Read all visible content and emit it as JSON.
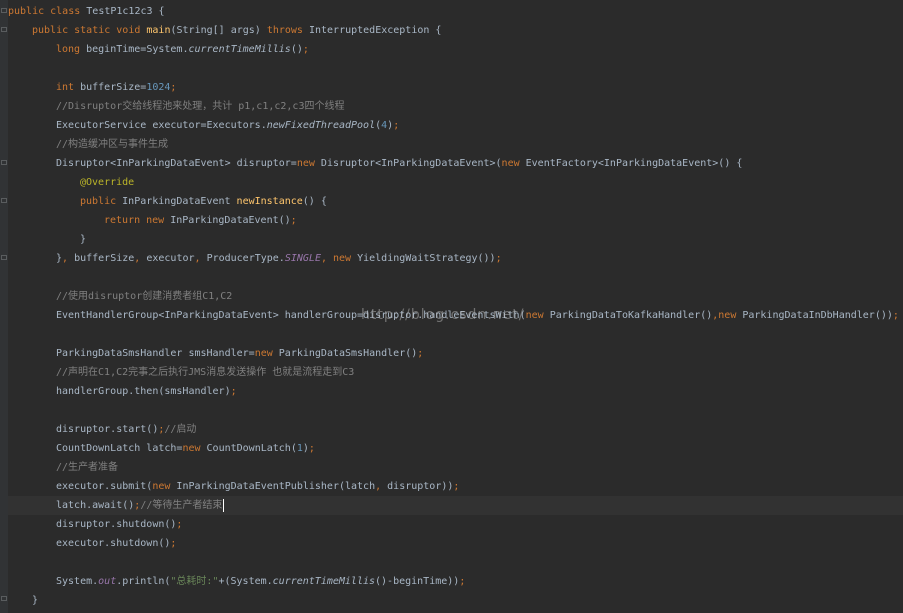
{
  "editor": {
    "language": "java",
    "theme": "Darcula",
    "lines": [
      {
        "indent": 0,
        "tokens": [
          {
            "t": "kw",
            "v": "public class "
          },
          {
            "t": "tx",
            "v": "TestP1c12c3 {"
          }
        ]
      },
      {
        "indent": 1,
        "tokens": [
          {
            "t": "kw",
            "v": "public static void "
          },
          {
            "t": "fn",
            "v": "main"
          },
          {
            "t": "tx",
            "v": "(String[] args) "
          },
          {
            "t": "kw",
            "v": "throws "
          },
          {
            "t": "tx",
            "v": "InterruptedException {"
          }
        ]
      },
      {
        "indent": 2,
        "tokens": [
          {
            "t": "kw",
            "v": "long "
          },
          {
            "t": "tx",
            "v": "beginTime=System."
          },
          {
            "t": "st",
            "v": "currentTimeMillis"
          },
          {
            "t": "tx",
            "v": "()"
          },
          {
            "t": "kw",
            "v": ";"
          }
        ]
      },
      {
        "indent": 0,
        "tokens": []
      },
      {
        "indent": 2,
        "tokens": [
          {
            "t": "kw",
            "v": "int "
          },
          {
            "t": "tx",
            "v": "bufferSize="
          },
          {
            "t": "num",
            "v": "1024"
          },
          {
            "t": "kw",
            "v": ";"
          }
        ]
      },
      {
        "indent": 2,
        "tokens": [
          {
            "t": "cm",
            "v": "//Disruptor交给线程池来处理，共计 p1,c1,c2,c3四个线程"
          }
        ]
      },
      {
        "indent": 2,
        "tokens": [
          {
            "t": "tx",
            "v": "ExecutorService executor=Executors."
          },
          {
            "t": "st",
            "v": "newFixedThreadPool"
          },
          {
            "t": "tx",
            "v": "("
          },
          {
            "t": "num",
            "v": "4"
          },
          {
            "t": "tx",
            "v": ")"
          },
          {
            "t": "kw",
            "v": ";"
          }
        ]
      },
      {
        "indent": 2,
        "tokens": [
          {
            "t": "cm",
            "v": "//构造缓冲区与事件生成"
          }
        ]
      },
      {
        "indent": 2,
        "tokens": [
          {
            "t": "tx",
            "v": "Disruptor<InParkingDataEvent> disruptor="
          },
          {
            "t": "kw",
            "v": "new "
          },
          {
            "t": "tx",
            "v": "Disruptor<InParkingDataEvent>("
          },
          {
            "t": "kw",
            "v": "new "
          },
          {
            "t": "tx",
            "v": "EventFactory<InParkingDataEvent>() {"
          }
        ]
      },
      {
        "indent": 3,
        "tokens": [
          {
            "t": "an",
            "v": "@Override"
          }
        ]
      },
      {
        "indent": 3,
        "tokens": [
          {
            "t": "kw",
            "v": "public "
          },
          {
            "t": "tx",
            "v": "InParkingDataEvent "
          },
          {
            "t": "fn",
            "v": "newInstance"
          },
          {
            "t": "tx",
            "v": "() {"
          }
        ]
      },
      {
        "indent": 4,
        "tokens": [
          {
            "t": "kw",
            "v": "return new "
          },
          {
            "t": "tx",
            "v": "InParkingDataEvent()"
          },
          {
            "t": "kw",
            "v": ";"
          }
        ]
      },
      {
        "indent": 3,
        "tokens": [
          {
            "t": "tx",
            "v": "}"
          }
        ]
      },
      {
        "indent": 2,
        "tokens": [
          {
            "t": "tx",
            "v": "}"
          },
          {
            "t": "kw",
            "v": ", "
          },
          {
            "t": "tx",
            "v": "bufferSize"
          },
          {
            "t": "kw",
            "v": ", "
          },
          {
            "t": "tx",
            "v": "executor"
          },
          {
            "t": "kw",
            "v": ", "
          },
          {
            "t": "tx",
            "v": "ProducerType."
          },
          {
            "t": "sf",
            "v": "SINGLE"
          },
          {
            "t": "kw",
            "v": ", new "
          },
          {
            "t": "tx",
            "v": "YieldingWaitStrategy())"
          },
          {
            "t": "kw",
            "v": ";"
          }
        ]
      },
      {
        "indent": 0,
        "tokens": []
      },
      {
        "indent": 2,
        "tokens": [
          {
            "t": "cm",
            "v": "//使用disruptor创建消费者组C1,C2"
          }
        ]
      },
      {
        "indent": 2,
        "tokens": [
          {
            "t": "tx",
            "v": "EventHandlerGroup<InParkingDataEvent> handlerGroup=disruptor.handleEventsWith("
          },
          {
            "t": "kw",
            "v": "new "
          },
          {
            "t": "tx",
            "v": "ParkingDataToKafkaHandler()"
          },
          {
            "t": "kw",
            "v": ",new "
          },
          {
            "t": "tx",
            "v": "ParkingDataInDbHandler())"
          },
          {
            "t": "kw",
            "v": ";"
          }
        ]
      },
      {
        "indent": 0,
        "tokens": []
      },
      {
        "indent": 2,
        "tokens": [
          {
            "t": "tx",
            "v": "ParkingDataSmsHandler smsHandler="
          },
          {
            "t": "kw",
            "v": "new "
          },
          {
            "t": "tx",
            "v": "ParkingDataSmsHandler()"
          },
          {
            "t": "kw",
            "v": ";"
          }
        ]
      },
      {
        "indent": 2,
        "tokens": [
          {
            "t": "cm",
            "v": "//声明在C1,C2完事之后执行JMS消息发送操作 也就是流程走到C3"
          }
        ]
      },
      {
        "indent": 2,
        "tokens": [
          {
            "t": "tx",
            "v": "handlerGroup.then(smsHandler)"
          },
          {
            "t": "kw",
            "v": ";"
          }
        ]
      },
      {
        "indent": 0,
        "tokens": []
      },
      {
        "indent": 2,
        "tokens": [
          {
            "t": "tx",
            "v": "disruptor.start()"
          },
          {
            "t": "kw",
            "v": ";"
          },
          {
            "t": "cm",
            "v": "//启动"
          }
        ]
      },
      {
        "indent": 2,
        "tokens": [
          {
            "t": "tx",
            "v": "CountDownLatch latch="
          },
          {
            "t": "kw",
            "v": "new "
          },
          {
            "t": "tx",
            "v": "CountDownLatch("
          },
          {
            "t": "num",
            "v": "1"
          },
          {
            "t": "tx",
            "v": ")"
          },
          {
            "t": "kw",
            "v": ";"
          }
        ]
      },
      {
        "indent": 2,
        "tokens": [
          {
            "t": "cm",
            "v": "//生产者准备"
          }
        ]
      },
      {
        "indent": 2,
        "tokens": [
          {
            "t": "tx",
            "v": "executor.submit("
          },
          {
            "t": "kw",
            "v": "new "
          },
          {
            "t": "tx",
            "v": "InParkingDataEventPublisher(latch"
          },
          {
            "t": "kw",
            "v": ", "
          },
          {
            "t": "tx",
            "v": "disruptor))"
          },
          {
            "t": "kw",
            "v": ";"
          }
        ]
      },
      {
        "indent": 2,
        "current": true,
        "tokens": [
          {
            "t": "tx",
            "v": "latch.await()"
          },
          {
            "t": "kw",
            "v": ";"
          },
          {
            "t": "cm",
            "v": "//等待生产者结束"
          }
        ]
      },
      {
        "indent": 2,
        "tokens": [
          {
            "t": "tx",
            "v": "disruptor.shutdown()"
          },
          {
            "t": "kw",
            "v": ";"
          }
        ]
      },
      {
        "indent": 2,
        "tokens": [
          {
            "t": "tx",
            "v": "executor.shutdown()"
          },
          {
            "t": "kw",
            "v": ";"
          }
        ]
      },
      {
        "indent": 0,
        "tokens": []
      },
      {
        "indent": 2,
        "tokens": [
          {
            "t": "tx",
            "v": "System."
          },
          {
            "t": "sf",
            "v": "out"
          },
          {
            "t": "tx",
            "v": ".println("
          },
          {
            "t": "str",
            "v": "\"总耗时:\""
          },
          {
            "t": "tx",
            "v": "+(System."
          },
          {
            "t": "st",
            "v": "currentTimeMillis"
          },
          {
            "t": "tx",
            "v": "()-beginTime))"
          },
          {
            "t": "kw",
            "v": ";"
          }
        ]
      },
      {
        "indent": 1,
        "tokens": [
          {
            "t": "tx",
            "v": "}"
          }
        ]
      }
    ]
  },
  "watermark": "http://blog.csdn.net/"
}
